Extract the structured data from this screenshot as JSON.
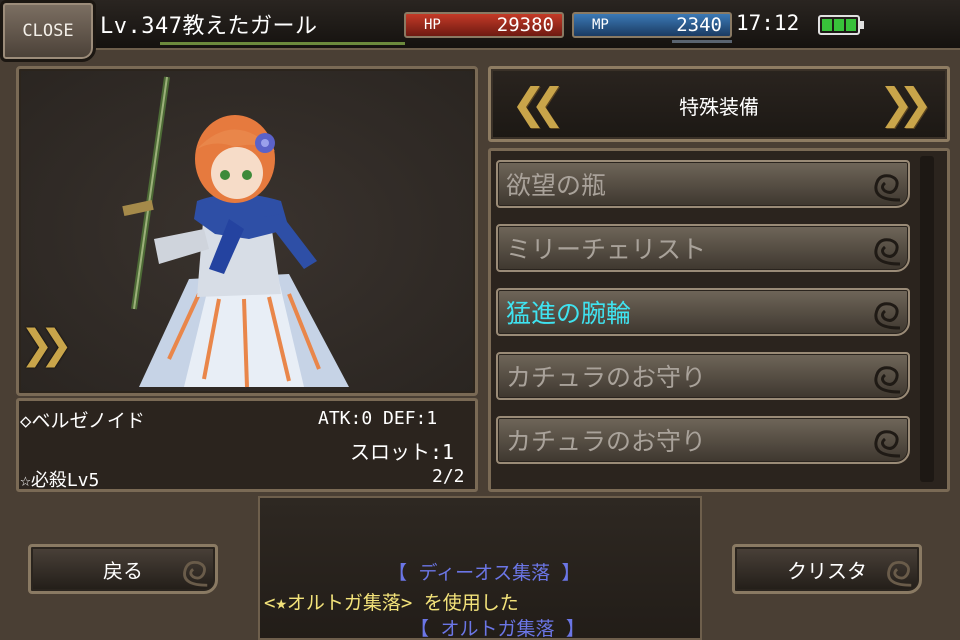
{
  "topbar": {
    "close_label": "CLOSE",
    "title": "Lv.347教えたガール",
    "hp_label": "HP",
    "hp_value": "29380",
    "mp_label": "MP",
    "mp_value": "2340",
    "clock": "17:12"
  },
  "character": {
    "name": "◇ベルゼノイド",
    "stats": "ATK:0 DEF:1",
    "slot": "スロット:1",
    "skill": "☆必殺Lv5",
    "page": "2/2"
  },
  "equipment": {
    "header": "特殊装備",
    "items": [
      {
        "label": "欲望の瓶",
        "active": false
      },
      {
        "label": "ミリーチェリスト",
        "active": false
      },
      {
        "label": "猛進の腕輪",
        "active": true
      },
      {
        "label": "カチュラのお守り",
        "active": false
      },
      {
        "label": "カチュラのお守り",
        "active": false
      }
    ]
  },
  "buttons": {
    "back": "戻る",
    "crysta": "クリスタ"
  },
  "messages": [
    "【 ディーオス集落 】",
    "<★オルトガ集落> を使用した",
    "【 オルトガ集落 】"
  ],
  "colors": {
    "hp": "#c43a27",
    "mp": "#3b79b6",
    "active_item": "#3fe3f0",
    "gold_arrow": "#c9a54a",
    "location_text": "#6b76e6",
    "message_text": "#f3e37a"
  },
  "icons": [
    "close-icon",
    "left-double-chevron-icon",
    "right-double-chevron-icon",
    "swirl-icon",
    "battery-icon"
  ]
}
